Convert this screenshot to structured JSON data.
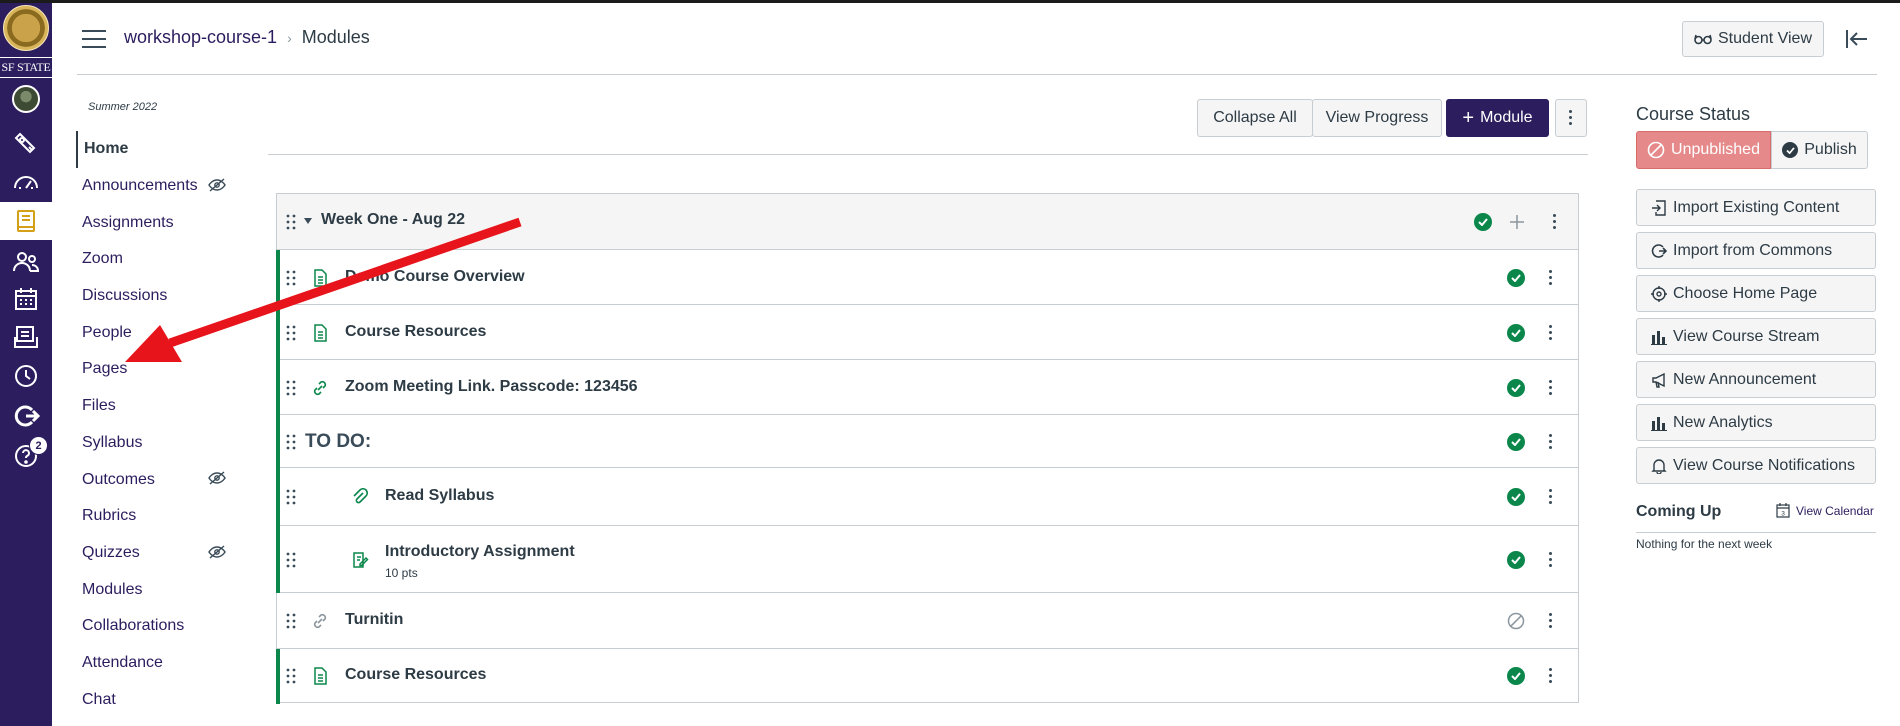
{
  "global_nav": {
    "logo_text": "SF STATE",
    "help_badge": "2",
    "icons": [
      "account-avatar-icon",
      "admin-icon",
      "dashboard-icon",
      "courses-icon",
      "groups-icon",
      "calendar-icon",
      "inbox-icon",
      "history-icon",
      "commons-icon",
      "help-icon"
    ]
  },
  "header": {
    "breadcrumb_course": "workshop-course-1",
    "breadcrumb_page": "Modules",
    "student_view": "Student View"
  },
  "course_nav": {
    "term": "Summer 2022",
    "items": [
      {
        "label": "Home",
        "active": true,
        "hidden": false
      },
      {
        "label": "Announcements",
        "active": false,
        "hidden": true
      },
      {
        "label": "Assignments",
        "active": false,
        "hidden": false
      },
      {
        "label": "Zoom",
        "active": false,
        "hidden": false
      },
      {
        "label": "Discussions",
        "active": false,
        "hidden": false
      },
      {
        "label": "People",
        "active": false,
        "hidden": false
      },
      {
        "label": "Pages",
        "active": false,
        "hidden": false
      },
      {
        "label": "Files",
        "active": false,
        "hidden": false
      },
      {
        "label": "Syllabus",
        "active": false,
        "hidden": false
      },
      {
        "label": "Outcomes",
        "active": false,
        "hidden": true
      },
      {
        "label": "Rubrics",
        "active": false,
        "hidden": false
      },
      {
        "label": "Quizzes",
        "active": false,
        "hidden": true
      },
      {
        "label": "Modules",
        "active": false,
        "hidden": false
      },
      {
        "label": "Collaborations",
        "active": false,
        "hidden": false
      },
      {
        "label": "Attendance",
        "active": false,
        "hidden": false
      },
      {
        "label": "Chat",
        "active": false,
        "hidden": false
      }
    ]
  },
  "toolbar": {
    "collapse_all": "Collapse All",
    "view_progress": "View Progress",
    "add_module": "Module",
    "add_symbol": "+"
  },
  "module": {
    "title": "Week One - Aug 22",
    "items": [
      {
        "title": "Demo Course Overview",
        "type": "page",
        "published": true,
        "indent": 0
      },
      {
        "title": "Course Resources",
        "type": "page",
        "published": true,
        "indent": 0
      },
      {
        "title": "Zoom Meeting Link. Passcode: 123456",
        "type": "link",
        "published": true,
        "indent": 0
      },
      {
        "title": "TO DO:",
        "type": "subheader",
        "published": true,
        "indent": 0
      },
      {
        "title": "Read Syllabus",
        "type": "attachment",
        "published": true,
        "indent": 1
      },
      {
        "title": "Introductory Assignment",
        "type": "assignment",
        "published": true,
        "indent": 1,
        "points": "10 pts"
      },
      {
        "title": "Turnitin",
        "type": "link",
        "published": false,
        "indent": 0
      },
      {
        "title": "Course Resources",
        "type": "page",
        "published": true,
        "indent": 0
      }
    ]
  },
  "sidebar": {
    "course_status": "Course Status",
    "unpublished": "Unpublished",
    "publish": "Publish",
    "buttons": [
      {
        "label": "Import Existing Content",
        "icon": "import-icon"
      },
      {
        "label": "Import from Commons",
        "icon": "commons-icon"
      },
      {
        "label": "Choose Home Page",
        "icon": "target-icon"
      },
      {
        "label": "View Course Stream",
        "icon": "bar-chart-icon"
      },
      {
        "label": "New Announcement",
        "icon": "megaphone-icon"
      },
      {
        "label": "New Analytics",
        "icon": "bar-chart-icon"
      },
      {
        "label": "View Course Notifications",
        "icon": "bell-icon"
      }
    ],
    "coming_up": "Coming Up",
    "view_calendar": "View Calendar",
    "calendar_day": "3",
    "nothing_text": "Nothing for the next week"
  },
  "colors": {
    "brand": "#2c1d5e",
    "published": "#0b874b",
    "unpublished_btn": "#e6898a",
    "annotation_arrow": "#e8141b"
  }
}
